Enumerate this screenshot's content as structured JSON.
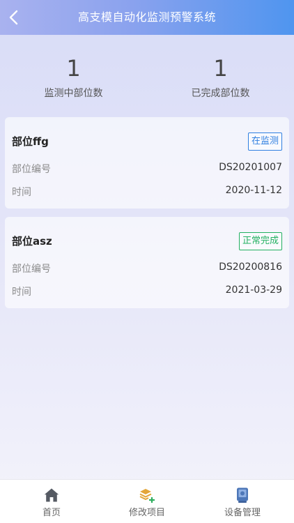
{
  "header": {
    "title": "高支模自动化监测预警系统"
  },
  "stats": [
    {
      "value": "1",
      "label": "监测中部位数"
    },
    {
      "value": "1",
      "label": "已完成部位数"
    }
  ],
  "cards": [
    {
      "name": "部位ffg",
      "status": "在监测",
      "status_color": "#2f7fe0",
      "fields": [
        {
          "label": "部位编号",
          "value": "DS20201007"
        },
        {
          "label": "时间",
          "value": "2020-11-12"
        }
      ]
    },
    {
      "name": "部位asz",
      "status": "正常完成",
      "status_color": "#22b060",
      "fields": [
        {
          "label": "部位编号",
          "value": "DS20200816"
        },
        {
          "label": "时间",
          "value": "2021-03-29"
        }
      ]
    }
  ],
  "tabbar": {
    "items": [
      {
        "label": "首页",
        "icon": "home-icon"
      },
      {
        "label": "修改项目",
        "icon": "layers-add-icon"
      },
      {
        "label": "设备管理",
        "icon": "device-icon"
      }
    ]
  }
}
